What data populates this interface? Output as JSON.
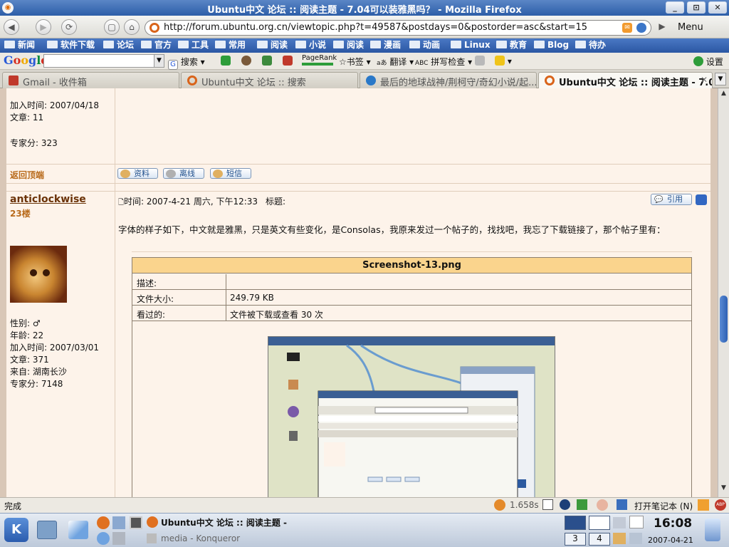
{
  "window": {
    "title": "Ubuntu中文 论坛 :: 阅读主题 - 7.04可以装雅黑吗？ - Mozilla Firefox",
    "buttons": [
      "_",
      "⊡",
      "✕"
    ]
  },
  "navbar": {
    "url": "http://forum.ubuntu.org.cn/viewtopic.php?t=49587&postdays=0&postorder=asc&start=15",
    "menu_label": "Menu"
  },
  "bookmarks": [
    "新闻",
    "软件下载",
    "论坛",
    "官方",
    "工具",
    "常用",
    "阅读",
    "小说",
    "阅读",
    "漫画",
    "动画",
    "Linux",
    "教育",
    "Blog",
    "待办"
  ],
  "gbar": {
    "logo": "Google",
    "search_label": "搜索",
    "pagerank": "PageRank",
    "bookmarks_label": "书签",
    "translate_label": "翻译",
    "spell_label": "拼写检查",
    "settings_label": "设置"
  },
  "tabs": [
    {
      "label": "Gmail - 收件箱"
    },
    {
      "label": "Ubuntu中文 论坛 :: 搜索"
    },
    {
      "label": "最后的地球战神/荆柯守/奇幻小说/起..."
    },
    {
      "label": "Ubuntu中文 论坛 :: 阅读主题 - 7.04..."
    }
  ],
  "post1": {
    "join_date": "加入时间: 2007/04/18",
    "posts": "文章: 11",
    "expert": "专家分: 323",
    "back_to_top": "返回顶端",
    "btn_profile": "资料",
    "btn_offline": "离线",
    "btn_pm": "短信"
  },
  "post2": {
    "username": "anticlockwise",
    "floor": "23楼",
    "gender": "性别: ♂",
    "age": "年龄: 22",
    "join_date": "加入时间: 2007/03/01",
    "posts": "文章: 371",
    "from": "来自: 湖南长沙",
    "expert": "专家分: 7148",
    "post_time": "时间: 2007-4-21 周六, 下午12:33",
    "subject_label": "标题:",
    "quote_label": "引用",
    "body": "字体的样子如下，中文就是雅黑，只是英文有些变化，是Consolas，我原来发过一个帖子的，找找吧，我忘了下载链接了，那个帖子里有：",
    "attachment": {
      "filename": "Screenshot-13.png",
      "rows": [
        {
          "label": "描述:",
          "value": ""
        },
        {
          "label": "文件大小:",
          "value": "249.79 KB"
        },
        {
          "label": "看过的:",
          "value": "文件被下载或查看 30 次"
        }
      ]
    }
  },
  "status": {
    "text": "完成",
    "time": "1.658s",
    "laptop_label": "打开笔记本 (N)"
  },
  "panel": {
    "task1": "Ubuntu中文 论坛 :: 阅读主题 -",
    "task2": "media - Konqueror",
    "desktops": [
      "3",
      "4"
    ],
    "clock": "16:08",
    "date": "2007-04-21"
  },
  "colors": {
    "title_bar": "#2d5ea8",
    "bookmark_bar": "#3a67b4",
    "post_bg": "#fdf3ea",
    "attach_header": "#fad48d",
    "username": "#6a3207"
  }
}
